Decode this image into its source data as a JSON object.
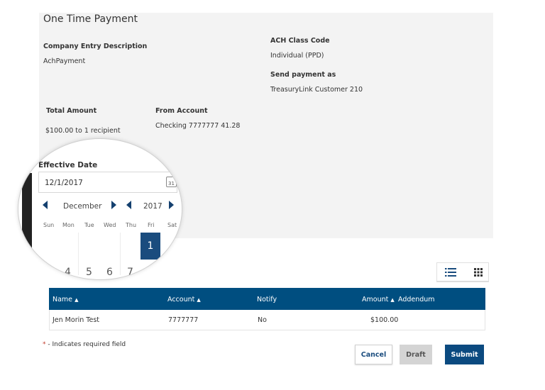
{
  "page": {
    "title": "One Time Payment"
  },
  "details": {
    "company_entry_label": "Company Entry Description",
    "company_entry_value": "AchPayment",
    "ach_class_label": "ACH Class Code",
    "ach_class_value": "Individual (PPD)",
    "send_as_label": "Send payment as",
    "send_as_value": "TreasuryLink Customer 210",
    "total_amount_label": "Total Amount",
    "total_amount_value": "$100.00 to 1 recipient",
    "from_account_label": "From Account",
    "from_account_value": "Checking 7777777 41.28"
  },
  "calendar": {
    "label": "Effective Date",
    "value": "12/1/2017",
    "calendar_icon_text": "31",
    "month": "December",
    "year": "2017",
    "weekdays": [
      "Sun",
      "Mon",
      "Tue",
      "Wed",
      "Thu",
      "Fri",
      "Sat"
    ],
    "selected_day": "1",
    "next_row_days": [
      "4",
      "5",
      "6",
      "7"
    ]
  },
  "table": {
    "columns": [
      "Name",
      "Account",
      "Notify",
      "Amount",
      "Addendum"
    ],
    "sort_indicator": "▲",
    "rows": [
      {
        "name": "Jen Morin Test",
        "account": "7777777",
        "notify": "No",
        "amount": "$100.00",
        "addendum": ""
      }
    ]
  },
  "footer": {
    "required_star": "*",
    "required_note": " - Indicates required field",
    "cancel_label": "Cancel",
    "draft_label": "Draft",
    "submit_label": "Submit"
  },
  "colors": {
    "primary": "#004e80",
    "selected_day": "#1a4c7e",
    "draft_button": "#d4d4d4",
    "required_star": "#c0392b"
  },
  "icons": {
    "list_view": "list-view-icon",
    "grid_view": "grid-view-icon",
    "calendar": "calendar-icon"
  }
}
